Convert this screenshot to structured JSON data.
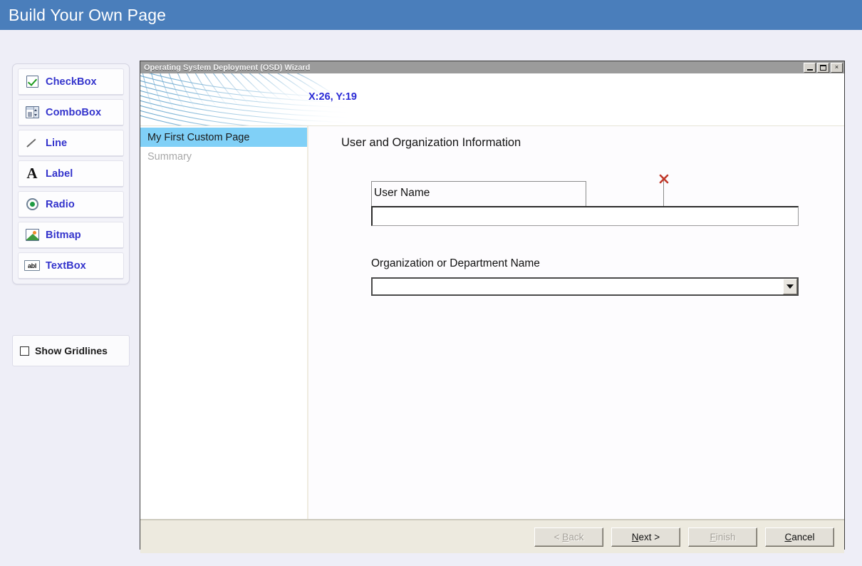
{
  "app": {
    "header_title": "Build Your Own Page",
    "header_color": "#4a7ebb"
  },
  "toolbox": {
    "items": [
      {
        "label": "CheckBox",
        "icon": "checkbox-icon"
      },
      {
        "label": "ComboBox",
        "icon": "combobox-icon"
      },
      {
        "label": "Line",
        "icon": "line-icon"
      },
      {
        "label": "Label",
        "icon": "label-a-icon"
      },
      {
        "label": "Radio",
        "icon": "radio-icon"
      },
      {
        "label": "Bitmap",
        "icon": "bitmap-icon"
      },
      {
        "label": "TextBox",
        "icon": "textbox-abl-icon"
      }
    ],
    "label_color": "#3333cc"
  },
  "gridlines": {
    "label": "Show Gridlines",
    "checked": false
  },
  "wizard": {
    "title": "Operating System Deployment (OSD) Wizard",
    "window_buttons": {
      "minimize": "minimize-icon",
      "maximize": "maximize-icon",
      "close": "×"
    },
    "banner": {
      "coordinates": "X:26, Y:19",
      "coordinate_color": "#2a2ad6"
    },
    "nav": {
      "items": [
        {
          "label": "My First Custom Page",
          "selected": true
        },
        {
          "label": "Summary",
          "selected": false
        }
      ],
      "selected_color": "#80d0f7"
    },
    "content": {
      "title": "User and Organization Information",
      "username_label": "User Name",
      "username_value": "",
      "org_label": "Organization or Department Name",
      "org_value": "",
      "selection_marker_color": "#c0392b"
    },
    "footer": {
      "buttons": [
        {
          "label": "< Back",
          "accel": "B",
          "enabled": false
        },
        {
          "label": "Next >",
          "accel": "N",
          "enabled": true
        },
        {
          "label": "Finish",
          "accel": "F",
          "enabled": false
        },
        {
          "label": "Cancel",
          "accel": "C",
          "enabled": true
        }
      ]
    }
  }
}
